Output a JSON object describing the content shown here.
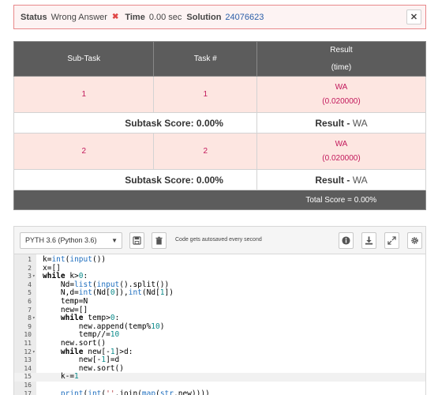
{
  "status": {
    "status_label": "Status",
    "status_value": "Wrong Answer",
    "time_label": "Time",
    "time_value": "0.00 sec",
    "solution_label": "Solution",
    "solution_value": "24076623"
  },
  "results": {
    "headers": [
      "Sub-Task",
      "Task #",
      "Result",
      "(time)"
    ],
    "tasks": [
      {
        "subtask": "1",
        "task": "1",
        "result": "WA",
        "time": "(0.020000)",
        "score_label": "Subtask Score: 0.00%",
        "result_label": "Result - ",
        "result_value": "WA"
      },
      {
        "subtask": "2",
        "task": "2",
        "result": "WA",
        "time": "(0.020000)",
        "score_label": "Subtask Score: 0.00%",
        "result_label": "Result - ",
        "result_value": "WA"
      }
    ],
    "total_label": "Total Score = 0.00%"
  },
  "editor": {
    "language": "PYTH 3.6 (Python 3.6)",
    "autosave_note": "Code gets autosaved every second",
    "code": [
      {
        "n": "1",
        "fold": "",
        "text": "k=int(input())"
      },
      {
        "n": "2",
        "fold": "",
        "text": "x=[]"
      },
      {
        "n": "3",
        "fold": "▾",
        "text": "while k>0:"
      },
      {
        "n": "4",
        "fold": "",
        "text": "    Nd=list(input().split())"
      },
      {
        "n": "5",
        "fold": "",
        "text": "    N,d=int(Nd[0]),int(Nd[1])"
      },
      {
        "n": "6",
        "fold": "",
        "text": "    temp=N"
      },
      {
        "n": "7",
        "fold": "",
        "text": "    new=[]"
      },
      {
        "n": "8",
        "fold": "▾",
        "text": "    while temp>0:"
      },
      {
        "n": "9",
        "fold": "",
        "text": "        new.append(temp%10)"
      },
      {
        "n": "10",
        "fold": "",
        "text": "        temp//=10"
      },
      {
        "n": "11",
        "fold": "",
        "text": "    new.sort()"
      },
      {
        "n": "12",
        "fold": "▾",
        "text": "    while new[-1]>d:"
      },
      {
        "n": "13",
        "fold": "",
        "text": "        new[-1]=d"
      },
      {
        "n": "14",
        "fold": "",
        "text": "        new.sort()"
      },
      {
        "n": "15",
        "fold": "",
        "text": "    k-=1"
      },
      {
        "n": "16",
        "fold": "",
        "text": ""
      },
      {
        "n": "17",
        "fold": "",
        "text": "    print(int(''.join(map(str,new))))"
      }
    ],
    "active_line": "15"
  },
  "icons": {
    "close": "close-icon",
    "save": "save-icon",
    "delete": "trash-icon",
    "info": "info-icon",
    "download": "download-icon",
    "fullscreen": "expand-icon",
    "settings": "gear-icon",
    "dropdown": "chevron-down-icon",
    "wrong": "cross-icon"
  },
  "colors": {
    "error_border": "#e8888b",
    "wa_row_bg": "#fde6e1",
    "header_bg": "#5c5c5c",
    "link": "#2a5ea8"
  }
}
